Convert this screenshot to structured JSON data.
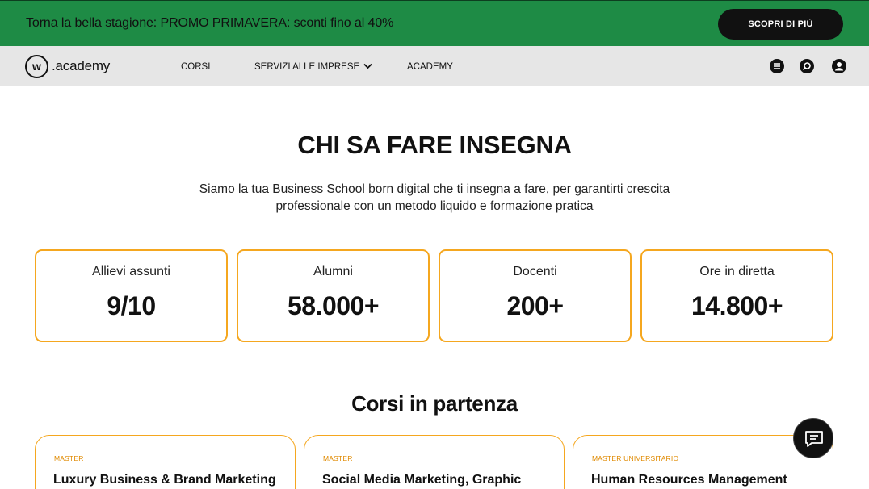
{
  "promo": {
    "text": "Torna la bella stagione: PROMO PRIMAVERA: sconti fino al 40%",
    "button": "SCOPRI DI PIÙ",
    "color": "#1e8b45"
  },
  "nav": {
    "logo_mark": "w",
    "logo_text": ".academy",
    "items": [
      "CORSI",
      "SERVIZI ALLE IMPRESE",
      "ACADEMY"
    ],
    "icons": [
      "menu-icon",
      "search-icon",
      "user-icon"
    ]
  },
  "hero": {
    "title": "CHI SA FARE INSEGNA",
    "subtitle": "Siamo la tua Business School born digital che ti insegna a fare, per garantirti crescita professionale con un metodo liquido e formazione pratica"
  },
  "stats": [
    {
      "label": "Allievi assunti",
      "value": "9/10"
    },
    {
      "label": "Alumni",
      "value": "58.000+"
    },
    {
      "label": "Docenti",
      "value": "200+"
    },
    {
      "label": "Ore in diretta",
      "value": "14.800+"
    }
  ],
  "courses": {
    "title": "Corsi in partenza",
    "items": [
      {
        "tag": "MASTER",
        "title": "Luxury Business & Brand Marketing"
      },
      {
        "tag": "MASTER",
        "title": "Social Media Marketing, Graphic"
      },
      {
        "tag": "MASTER UNIVERSITARIO",
        "title": "Human Resources Management"
      }
    ]
  },
  "colors": {
    "accent": "#f5a71f",
    "dark": "#111111",
    "nav_bg": "#e6e6e6"
  }
}
